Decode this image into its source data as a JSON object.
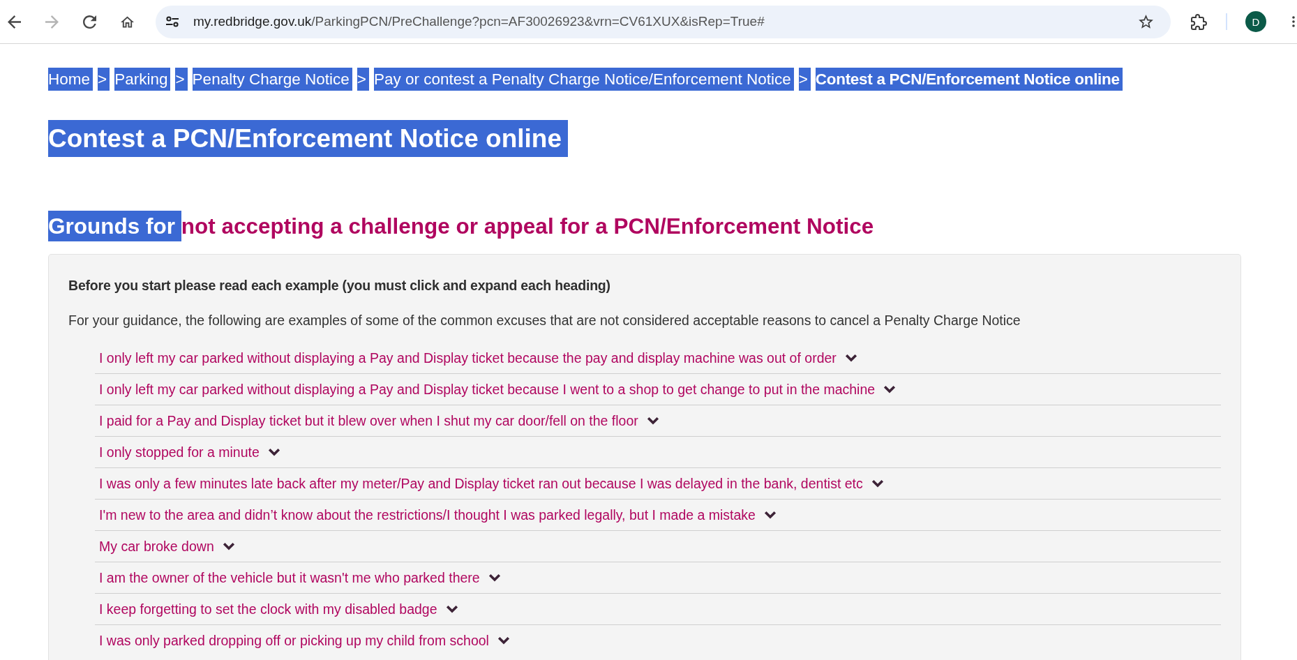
{
  "browser": {
    "nav_buttons": [
      {
        "kind": "back",
        "disabled": false
      },
      {
        "kind": "forward",
        "disabled": true
      },
      {
        "kind": "reload",
        "disabled": false
      },
      {
        "kind": "home",
        "disabled": false
      }
    ],
    "address": {
      "host": "my.redbridge.gov.uk",
      "path": "/ParkingPCN/PreChallenge?pcn=AF30026923&vrn=CV61XUX&isRep=True#"
    },
    "profile_initial": "D"
  },
  "breadcrumb": [
    {
      "kind": "link",
      "label": "Home",
      "highlighted": true
    },
    {
      "kind": "separator",
      "label": ">",
      "highlighted": true
    },
    {
      "kind": "link",
      "label": "Parking",
      "highlighted": true
    },
    {
      "kind": "separator",
      "label": ">",
      "highlighted": true
    },
    {
      "kind": "link",
      "label": "Penalty Charge Notice",
      "highlighted": true
    },
    {
      "kind": "separator",
      "label": ">",
      "highlighted": true
    },
    {
      "kind": "link",
      "label": "Pay or contest a Penalty Charge Notice/Enforcement Notice",
      "highlighted": true
    },
    {
      "kind": "separator",
      "label": ">",
      "highlighted": true
    },
    {
      "kind": "current",
      "label": "Contest a PCN/Enforcement Notice online",
      "highlighted": true
    }
  ],
  "page_title": {
    "text": "Contest a PCN/Enforcement Notice online",
    "highlighted": true
  },
  "section_heading": {
    "parts": [
      {
        "text": "Grounds for ",
        "highlighted": true
      },
      {
        "text": "not accepting a challenge or appeal for a PCN/Enforcement Notice",
        "highlighted": false
      }
    ]
  },
  "panel": {
    "instruction": "Before you start please read each example (you must click and expand each heading)",
    "intro": "For your guidance, the following are examples of some of the common excuses that are not considered acceptable reasons to cancel a Penalty Charge Notice",
    "items": [
      {
        "text": "I only left my car parked without displaying a Pay and Display ticket because the pay and display machine was out of order",
        "expanded": false
      },
      {
        "text": "I only left my car parked without displaying a Pay and Display ticket because I went to a shop to get change to put in the machine",
        "expanded": false
      },
      {
        "text": "I paid for a Pay and Display ticket but it blew over when I shut my car door/fell on the floor",
        "expanded": false
      },
      {
        "text": "I only stopped for a minute",
        "expanded": false
      },
      {
        "text": "I was only a few minutes late back after my meter/Pay and Display ticket ran out because I was delayed in the bank, dentist etc",
        "expanded": false
      },
      {
        "text": "I'm new to the area and didn’t know about the restrictions/I thought I was parked legally, but I made a mistake",
        "expanded": false
      },
      {
        "text": "My car broke down",
        "expanded": false
      },
      {
        "text": "I am the owner of the vehicle but it wasn't me who parked there",
        "expanded": false
      },
      {
        "text": "I keep forgetting to set the clock with my disabled badge",
        "expanded": false
      },
      {
        "text": "I was only parked dropping off or picking up my child from school",
        "expanded": false
      }
    ]
  }
}
